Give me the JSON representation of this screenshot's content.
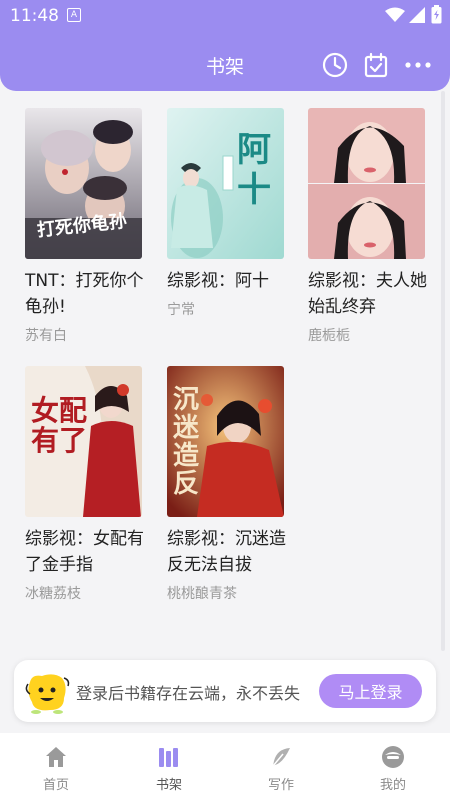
{
  "status_bar": {
    "time": "11:48",
    "notification_icon_letter": "A"
  },
  "header": {
    "title": "书架",
    "icons": [
      "clock-icon",
      "calendar-check-icon",
      "more-dots-icon"
    ]
  },
  "books": [
    {
      "title": "TNT：打死你个龟孙!",
      "author": "苏有白",
      "cover_text": "打死你龟孙"
    },
    {
      "title": "综影视：阿十",
      "author": "宁常",
      "cover_text": "阿十"
    },
    {
      "title": "综影视：夫人她始乱终弃",
      "author": "鹿栀栀",
      "cover_text": ""
    },
    {
      "title": "综影视：女配有了金手指",
      "author": "冰糖荔枝",
      "cover_text": "女配有了"
    },
    {
      "title": "综影视：沉迷造反无法自拔",
      "author": "桃桃酿青茶",
      "cover_text": "沉迷造反"
    }
  ],
  "login_banner": {
    "text": "登录后书籍存在云端，永不丢失",
    "button_label": "马上登录"
  },
  "tabs": [
    {
      "label": "首页",
      "icon": "home-icon"
    },
    {
      "label": "书架",
      "icon": "bookshelf-icon",
      "active": true
    },
    {
      "label": "写作",
      "icon": "feather-icon"
    },
    {
      "label": "我的",
      "icon": "profile-icon"
    }
  ],
  "colors": {
    "accent": "#9b8cf0",
    "button": "#b08cf5",
    "active_tab": "#9b8cf0"
  }
}
